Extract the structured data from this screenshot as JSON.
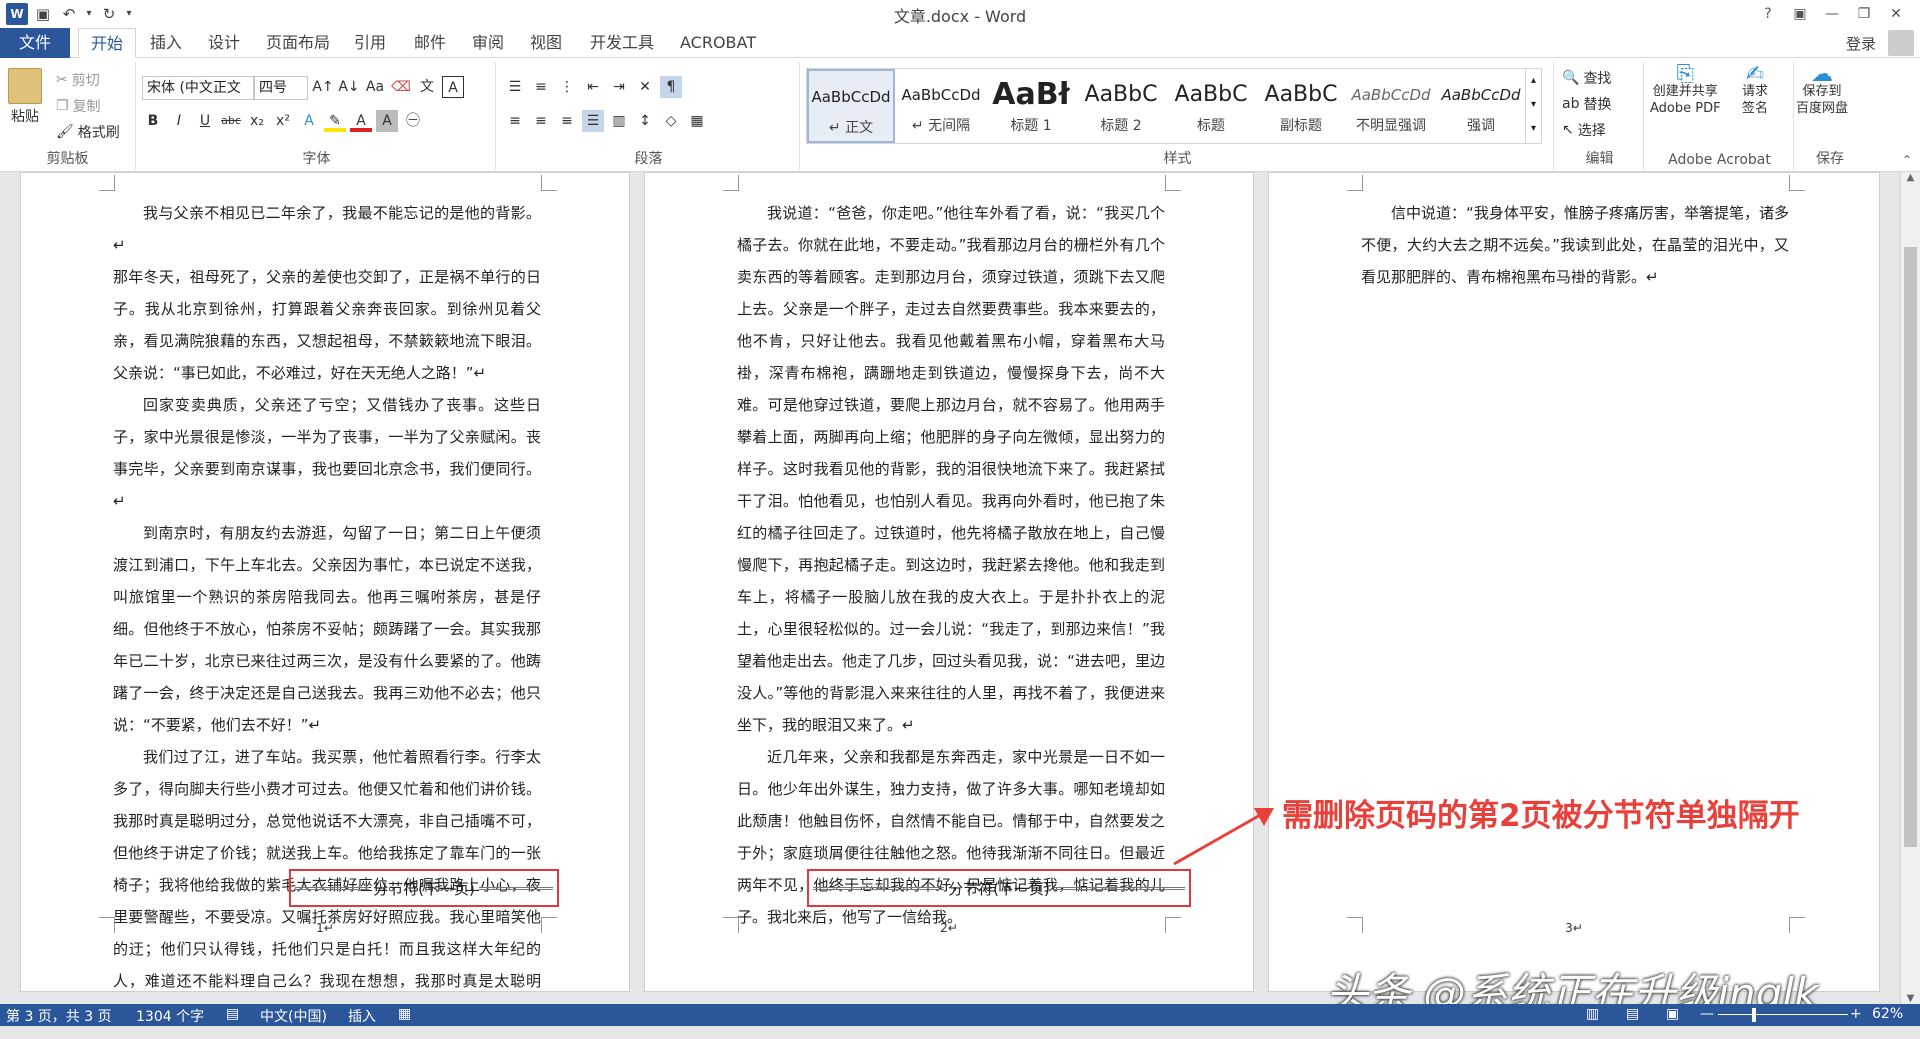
{
  "window": {
    "title": "文章.docx - Word",
    "controls": [
      "?",
      "▣",
      "—",
      "❐",
      "✕"
    ]
  },
  "qat": {
    "icons": [
      "word-logo",
      "save-icon",
      "undo-icon",
      "redo-icon"
    ]
  },
  "tabs": [
    "文件",
    "开始",
    "插入",
    "设计",
    "页面布局",
    "引用",
    "邮件",
    "审阅",
    "视图",
    "开发工具",
    "ACROBAT"
  ],
  "account": {
    "login": "登录"
  },
  "ribbon": {
    "clipboard": {
      "label": "剪贴板",
      "paste": "粘贴",
      "cut": "剪切",
      "copy": "复制",
      "format_painter": "格式刷"
    },
    "font": {
      "label": "字体",
      "font_name": "宋体 (中文正文",
      "font_size": "四号"
    },
    "paragraph": {
      "label": "段落"
    },
    "styles": {
      "label": "样式",
      "items": [
        {
          "preview": "AaBbCcDd",
          "name": "↵ 正文"
        },
        {
          "preview": "AaBbCcDd",
          "name": "↵ 无间隔"
        },
        {
          "preview": "AaBł",
          "name": "标题 1"
        },
        {
          "preview": "AaBbC",
          "name": "标题 2"
        },
        {
          "preview": "AaBbC",
          "name": "标题"
        },
        {
          "preview": "AaBbC",
          "name": "副标题"
        },
        {
          "preview": "AaBbCcDd",
          "name": "不明显强调"
        },
        {
          "preview": "AaBbCcDd",
          "name": "强调"
        }
      ]
    },
    "editing": {
      "label": "编辑",
      "find": "查找",
      "replace": "替换",
      "select": "选择"
    },
    "acrobat": {
      "label": "Adobe Acrobat",
      "create": "创建并共享\nAdobe PDF",
      "create_l1": "创建并共享",
      "create_l2": "Adobe PDF",
      "request_l1": "请求",
      "request_l2": "签名"
    },
    "save": {
      "label": "保存",
      "l1": "保存到",
      "l2": "百度网盘"
    }
  },
  "pages": [
    {
      "paragraphs": [
        "我与父亲不相见已二年余了，我最不能忘记的是他的背影。↵",
        "那年冬天，祖母死了，父亲的差使也交卸了，正是祸不单行的日子。我从北京到徐州，打算跟着父亲奔丧回家。到徐州见着父亲，看见满院狼藉的东西，又想起祖母，不禁簌簌地流下眼泪。父亲说：“事已如此，不必难过，好在天无绝人之路！”↵",
        "回家变卖典质，父亲还了亏空；又借钱办了丧事。这些日子，家中光景很是惨淡，一半为了丧事，一半为了父亲赋闲。丧事完毕，父亲要到南京谋事，我也要回北京念书，我们便同行。↵",
        "到南京时，有朋友约去游逛，勾留了一日；第二日上午便须渡江到浦口，下午上车北去。父亲因为事忙，本已说定不送我，叫旅馆里一个熟识的茶房陪我同去。他再三嘱咐茶房，甚是仔细。但他终于不放心，怕茶房不妥帖；颇踌躇了一会。其实我那年已二十岁，北京已来往过两三次，是没有什么要紧的了。他踌躇了一会，终于决定还是自己送我去。我再三劝他不必去；他只说：“不要紧，他们去不好！”↵",
        "我们过了江，进了车站。我买票，他忙着照看行李。行李太多了，得向脚夫行些小费才可过去。他便又忙着和他们讲价钱。我那时真是聪明过分，总觉他说话不大漂亮，非自己插嘴不可，但他终于讲定了价钱；就送我上车。他给我拣定了靠车门的一张椅子；我将他给我做的紫毛大衣铺好座位。他嘱我路上小心，夜里要警醒些，不要受凉。又嘱托茶房好好照应我。我心里暗笑他的迂；他们只认得钱，托他们只是白托！而且我这样大年纪的人，难道还不能料理自己么？我现在想想，我那时真是太聪明了。"
      ],
      "page_number": "1↵"
    },
    {
      "paragraphs": [
        "我说道：“爸爸，你走吧。”他往车外看了看，说：“我买几个橘子去。你就在此地，不要走动。”我看那边月台的栅栏外有几个卖东西的等着顾客。走到那边月台，须穿过铁道，须跳下去又爬上去。父亲是一个胖子，走过去自然要费事些。我本来要去的，他不肯，只好让他去。我看见他戴着黑布小帽，穿着黑布大马褂，深青布棉袍，蹒跚地走到铁道边，慢慢探身下去，尚不大难。可是他穿过铁道，要爬上那边月台，就不容易了。他用两手攀着上面，两脚再向上缩；他肥胖的身子向左微倾，显出努力的样子。这时我看见他的背影，我的泪很快地流下来了。我赶紧拭干了泪。怕他看见，也怕别人看见。我再向外看时，他已抱了朱红的橘子往回走了。过铁道时，他先将橘子散放在地上，自己慢慢爬下，再抱起橘子走。到这边时，我赶紧去搀他。他和我走到车上，将橘子一股脑儿放在我的皮大衣上。于是扑扑衣上的泥土，心里很轻松似的。过一会儿说：“我走了，到那边来信！”我望着他走出去。他走了几步，回过头看见我，说：“进去吧，里边没人。”等他的背影混入来来往往的人里，再找不着了，我便进来坐下，我的眼泪又来了。↵",
        "近几年来，父亲和我都是东奔西走，家中光景是一日不如一日。他少年出外谋生，独力支持，做了许多大事。哪知老境却如此颓唐！他触目伤怀，自然情不能自已。情郁于中，自然要发之于外；家庭琐屑便往往触他之怒。他待我渐渐不同往日。但最近两年不见，他终于忘却我的不好，只是惦记着我，惦记着我的儿子。我北来后，他写了一信给我。"
      ],
      "page_number": "2↵"
    },
    {
      "paragraphs": [
        "信中说道：“我身体平安，惟膀子疼痛厉害，举箸提笔，诸多不便，大约大去之期不远矣。”我读到此处，在晶莹的泪光中，又看见那肥胖的、青布棉袍黑布马褂的背影。↵"
      ],
      "page_number": "3↵"
    }
  ],
  "section_break": "分节符(下一页)",
  "annotation": "需删除页码的第2页被分节符单独隔开",
  "watermark": "头条 @系统正在升级inglk",
  "status": {
    "page": "第 3 页，共 3 页",
    "words": "1304 个字",
    "lang": "中文(中国)",
    "mode": "插入",
    "zoom": "62%"
  },
  "colors": {
    "accent": "#2b579a",
    "highlight": "#e03a3a"
  }
}
